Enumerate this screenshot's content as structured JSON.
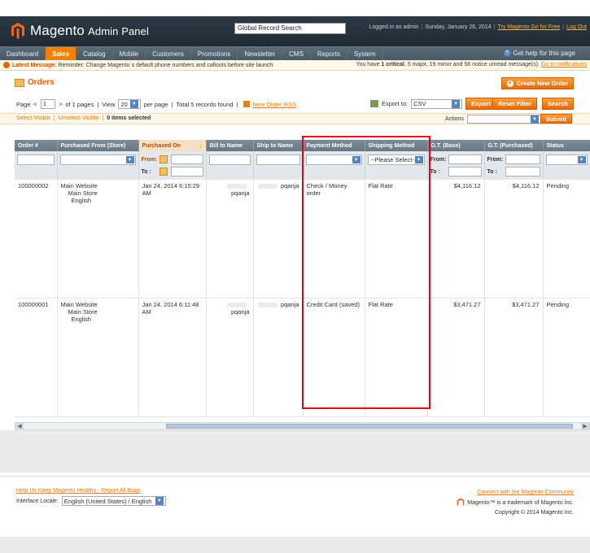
{
  "header": {
    "logo_text": "Magento",
    "logo_sub": "Admin Panel",
    "search_placeholder": "Global Record Search",
    "logged_in": "Logged in as admin",
    "date": "Sunday, January 26, 2014",
    "try_link": "Try Magento Go for Free",
    "logout_link": "Log Out"
  },
  "nav": {
    "items": [
      "Dashboard",
      "Sales",
      "Catalog",
      "Mobile",
      "Customers",
      "Promotions",
      "Newsletter",
      "CMS",
      "Reports",
      "System"
    ],
    "active": "Sales",
    "help": "Get help for this page"
  },
  "message": {
    "label": "Latest Message:",
    "text": "Reminder: Change Magento`s default phone numbers and callouts before site launch",
    "summary_prefix": "You have",
    "critical": "1 critical",
    "rest": ", 5 major, 19 minor and 56 notice unread message(s).",
    "link": "Go to notifications"
  },
  "page": {
    "title": "Orders",
    "create_button": "Create New Order"
  },
  "pager": {
    "page_label": "Page",
    "page_value": "1",
    "of_pages": "of 1 pages",
    "view_label": "View",
    "view_value": "20",
    "per_page": "per page",
    "total": "Total 5 records found",
    "rss_link": "New Order RSS",
    "export_label": "Export to:",
    "export_value": "CSV",
    "export_button": "Export",
    "reset_button": "Reset Filter",
    "search_button": "Search"
  },
  "massaction": {
    "select_visible": "Select Visible",
    "unselect_visible": "Unselect Visible",
    "selected": "0 items selected",
    "actions_label": "Actions",
    "submit": "Submit"
  },
  "grid": {
    "columns": [
      "Order #",
      "Purchased From (Store)",
      "Purchased On",
      "Bill to Name",
      "Ship to Name",
      "Payment Method",
      "Shipping Method",
      "G.T. (Base)",
      "G.T. (Purchased)",
      "Status"
    ],
    "filter_from": "From:",
    "filter_to": "To :",
    "shipping_placeholder": "--Please Select--",
    "rows": [
      {
        "order": "100000002",
        "store": [
          "Main Website",
          "Main Store",
          "English"
        ],
        "purchased_on": "Jan 24, 2014 6:15:29 AM",
        "bill_to": "pqanja",
        "ship_to": "pqanja",
        "payment": "Check / Money order",
        "shipping": "Flat Rate",
        "gt_base": "$4,116.12",
        "gt_purchased": "$4,116.12",
        "status": "Pending"
      },
      {
        "order": "100000001",
        "store": [
          "Main Website",
          "Main Store",
          "English"
        ],
        "purchased_on": "Jan 24, 2014 6:11:48 AM",
        "bill_to": "pqanja",
        "ship_to": "pqanja",
        "payment": "Credit Card (saved)",
        "shipping": "Flat Rate",
        "gt_base": "$3,471.27",
        "gt_purchased": "$3,471.27",
        "status": "Pending"
      }
    ]
  },
  "footer": {
    "healthy_link": "Help Us Keep Magento Healthy - Report All Bugs",
    "locale_label": "Interface Locale:",
    "locale_value": "English (United States) / English",
    "community_link": "Connect with the Magento Community",
    "trademark": "Magento™ is a trademark of Magento Inc.",
    "copyright": "Copyright © 2014 Magento Inc."
  },
  "colors": {
    "accent": "#f18200",
    "highlight": "#e60012",
    "header": "#2d3a45"
  }
}
